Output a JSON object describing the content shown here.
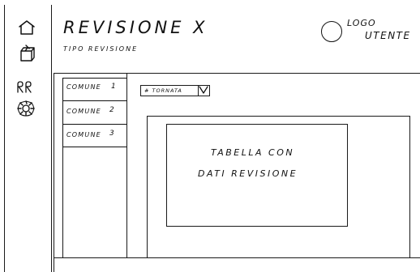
{
  "header": {
    "title": "REVISIONE X",
    "subtitle": "TIPO REVISIONE",
    "user_logo_line1": "LOGO",
    "user_logo_line2": "UTENTE"
  },
  "sidebar": {
    "icons": [
      "home-icon",
      "box-icon",
      "people-icon",
      "gear-icon"
    ],
    "tag_text": "RR"
  },
  "comuni": {
    "items": [
      {
        "label": "COMUNE",
        "num": "1"
      },
      {
        "label": "COMUNE",
        "num": "2"
      },
      {
        "label": "COMUNE",
        "num": "3"
      }
    ]
  },
  "selector": {
    "value": "# TORNATA"
  },
  "table": {
    "line1": "TABELLA CON",
    "line2": "DATI REVISIONE"
  }
}
